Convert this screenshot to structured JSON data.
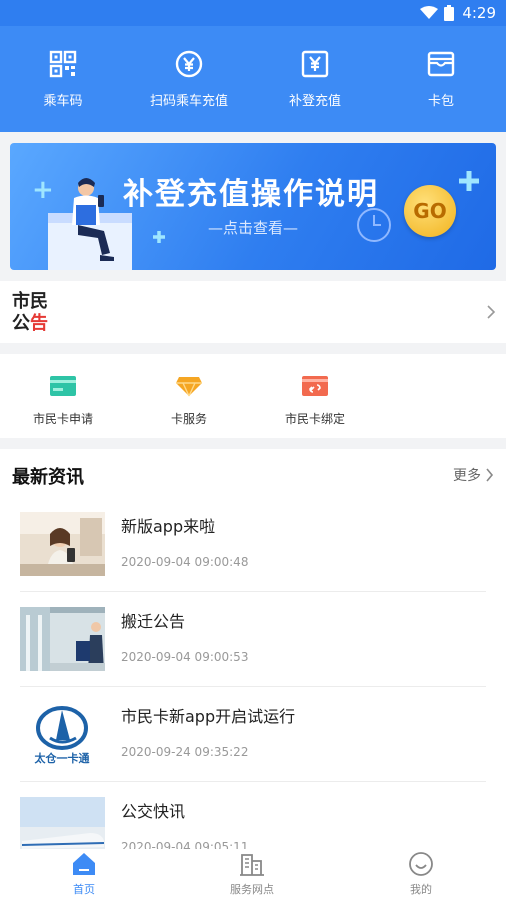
{
  "status": {
    "time": "4:29"
  },
  "quick_actions": [
    {
      "label": "乘车码",
      "icon": "qr-code-icon"
    },
    {
      "label": "扫码乘车充值",
      "icon": "yen-circle-icon"
    },
    {
      "label": "补登充值",
      "icon": "yen-card-icon"
    },
    {
      "label": "卡包",
      "icon": "card-wallet-icon"
    }
  ],
  "banner": {
    "title": "补登充值操作说明",
    "subtitle": "—点击查看—",
    "go_label": "GO"
  },
  "notice": {
    "title_line1": "市民",
    "title_line2_first": "公",
    "title_line2_second": "告"
  },
  "services": [
    {
      "label": "市民卡申请",
      "icon": "card-apply-icon",
      "color": "#2ec4a6"
    },
    {
      "label": "卡服务",
      "icon": "diamond-service-icon",
      "color": "#f5a623"
    },
    {
      "label": "市民卡绑定",
      "icon": "card-bind-icon",
      "color": "#f26a4f"
    }
  ],
  "news": {
    "title": "最新资讯",
    "more_label": "更多",
    "items": [
      {
        "title": "新版app来啦",
        "date": "2020-09-04 09:00:48"
      },
      {
        "title": "搬迁公告",
        "date": "2020-09-04 09:00:53"
      },
      {
        "title": "市民卡新app开启试运行",
        "date": "2020-09-24 09:35:22",
        "logo_text": "太仓一卡通"
      },
      {
        "title": "公交快讯",
        "date": "2020-09-04 09:05:11"
      }
    ]
  },
  "nav": [
    {
      "label": "首页",
      "icon": "home-icon",
      "active": true
    },
    {
      "label": "服务网点",
      "icon": "building-icon",
      "active": false
    },
    {
      "label": "我的",
      "icon": "smiley-icon",
      "active": false
    }
  ],
  "colors": {
    "primary": "#3d8bf5",
    "status_bar": "#2f7ef0",
    "notice_red": "#e53935"
  }
}
